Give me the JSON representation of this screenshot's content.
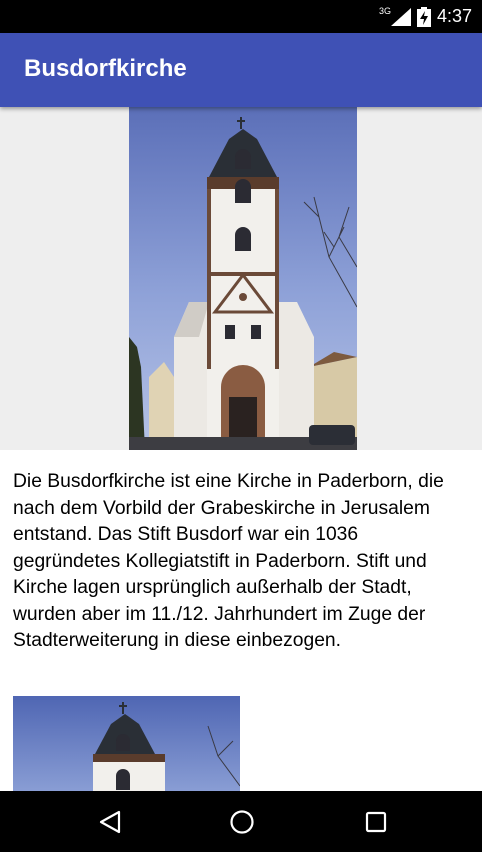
{
  "status_bar": {
    "network": "3G",
    "time": "4:37",
    "icons": [
      "signal-icon",
      "battery-charging-icon"
    ]
  },
  "app_bar": {
    "title": "Busdorfkirche"
  },
  "content": {
    "description": "Die Busdorfkirche ist eine Kirche in Paderborn, die nach dem Vorbild der Grabeskirche in Jerusalem entstand. Das Stift Busdorf war ein 1036 gegründetes Kollegiatstift in Paderborn. Stift und Kirche lagen ursprünglich außerhalb der Stadt, wurden aber im 11./12. Jahrhundert im Zuge der Stadterweiterung in diese einbezogen.",
    "images": [
      "church-tower-photo",
      "church-tower-photo-2"
    ]
  },
  "nav_bar": {
    "buttons": [
      "back-icon",
      "home-icon",
      "recents-icon"
    ]
  },
  "colors": {
    "app_bar": "#3f51b5",
    "status_bar": "#000000",
    "nav_bar": "#000000",
    "hero_background": "#eeeeee"
  }
}
